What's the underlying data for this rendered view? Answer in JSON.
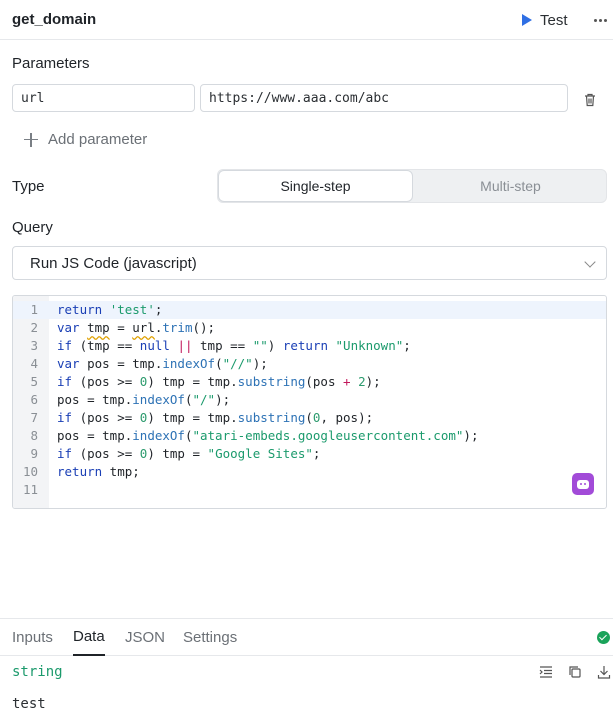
{
  "header": {
    "title": "get_domain",
    "test_label": "Test",
    "more_icon": "more-horizontal-icon"
  },
  "parameters": {
    "label": "Parameters",
    "items": [
      {
        "name": "url",
        "value": "https://www.aaa.com/abc"
      }
    ],
    "add_label": "Add parameter"
  },
  "type": {
    "label": "Type",
    "options": [
      "Single-step",
      "Multi-step"
    ],
    "selected": "Single-step"
  },
  "query": {
    "label": "Query",
    "selected": "Run JS Code (javascript)"
  },
  "editor": {
    "line_numbers": [
      "1",
      "2",
      "3",
      "4",
      "5",
      "6",
      "7",
      "8",
      "9",
      "10",
      "11"
    ],
    "lines": [
      "return 'test';",
      "var tmp = url.trim();",
      "if (tmp == null || tmp == \"\") return \"Unknown\";",
      "var pos = tmp.indexOf(\"//\");",
      "if (pos >= 0) tmp = tmp.substring(pos + 2);",
      "pos = tmp.indexOf(\"/\");",
      "if (pos >= 0) tmp = tmp.substring(0, pos);",
      "pos = tmp.indexOf(\"atari-embeds.googleusercontent.com\");",
      "if (pos >= 0) tmp = \"Google Sites\";",
      "return tmp;",
      ""
    ],
    "active_line": 1
  },
  "output": {
    "tabs": [
      "Inputs",
      "Data",
      "JSON",
      "Settings"
    ],
    "active_tab": "Data",
    "status": "success",
    "type_tag": "string",
    "value": "test"
  },
  "colors": {
    "accent": "#2f6fe4",
    "success": "#1aa35a",
    "ai": "#a24bd8",
    "string": "#1b9a6c",
    "keyword": "#1a3fb5"
  }
}
